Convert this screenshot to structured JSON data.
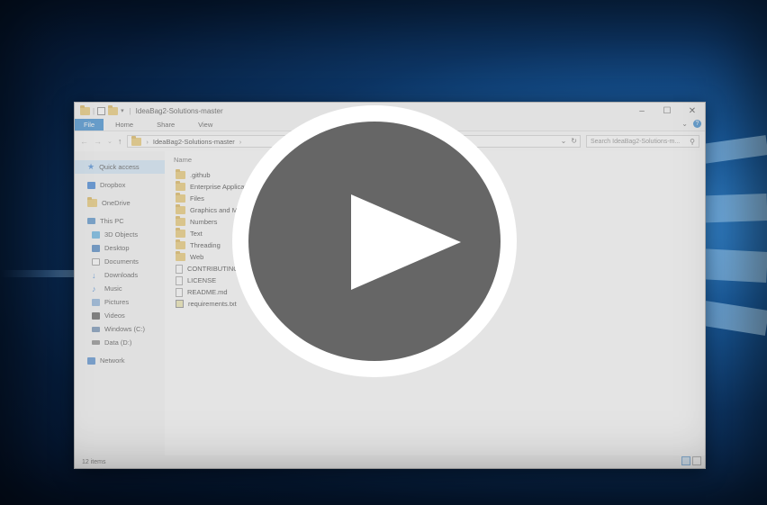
{
  "window": {
    "title": "IdeaBag2-Solutions-master",
    "controls": {
      "minimize": "–",
      "maximize": "☐",
      "close": "✕"
    }
  },
  "ribbon": {
    "tabs": [
      "File",
      "Home",
      "Share",
      "View"
    ]
  },
  "address": {
    "path": "IdeaBag2-Solutions-master",
    "search_placeholder": "Search IdeaBag2-Solutions-m..."
  },
  "sidebar": {
    "items": [
      {
        "label": "Quick access",
        "icon": "star-icon",
        "color": "#2b78d4"
      },
      {
        "label": "Dropbox",
        "icon": "dropbox-icon",
        "color": "#1f6fd1"
      },
      {
        "label": "OneDrive",
        "icon": "folder-icon",
        "color": "#e8c25c"
      },
      {
        "label": "This PC",
        "icon": "computer-icon",
        "color": "#3a80c4"
      },
      {
        "label": "3D Objects",
        "icon": "cube-icon",
        "color": "#4aa8e0"
      },
      {
        "label": "Desktop",
        "icon": "desktop-icon",
        "color": "#2d6fb8"
      },
      {
        "label": "Documents",
        "icon": "documents-icon",
        "color": "#8a8a8a"
      },
      {
        "label": "Downloads",
        "icon": "download-icon",
        "color": "#2a7ad2"
      },
      {
        "label": "Music",
        "icon": "music-icon",
        "color": "#2a7ad2"
      },
      {
        "label": "Pictures",
        "icon": "pictures-icon",
        "color": "#7aa6d6"
      },
      {
        "label": "Videos",
        "icon": "videos-icon",
        "color": "#444444"
      },
      {
        "label": "Windows (C:)",
        "icon": "drive-icon",
        "color": "#5a7fa8"
      },
      {
        "label": "Data (D:)",
        "icon": "drive-icon",
        "color": "#777777"
      },
      {
        "label": "Network",
        "icon": "network-icon",
        "color": "#3a7cc8"
      }
    ]
  },
  "main": {
    "column_name": "Name",
    "files": [
      {
        "name": ".github",
        "type": "folder"
      },
      {
        "name": "Enterprise Applications",
        "type": "folder"
      },
      {
        "name": "Files",
        "type": "folder"
      },
      {
        "name": "Graphics and Multimedia",
        "type": "folder"
      },
      {
        "name": "Numbers",
        "type": "folder"
      },
      {
        "name": "Text",
        "type": "folder"
      },
      {
        "name": "Threading",
        "type": "folder"
      },
      {
        "name": "Web",
        "type": "folder"
      },
      {
        "name": "CONTRIBUTING.md",
        "type": "doc"
      },
      {
        "name": "LICENSE",
        "type": "doc"
      },
      {
        "name": "README.md",
        "type": "doc"
      },
      {
        "name": "requirements.txt",
        "type": "txt"
      }
    ]
  },
  "status": {
    "items_count": "12 items"
  },
  "colors": {
    "accent": "#1979ca",
    "overlay_disc": "#666666"
  }
}
